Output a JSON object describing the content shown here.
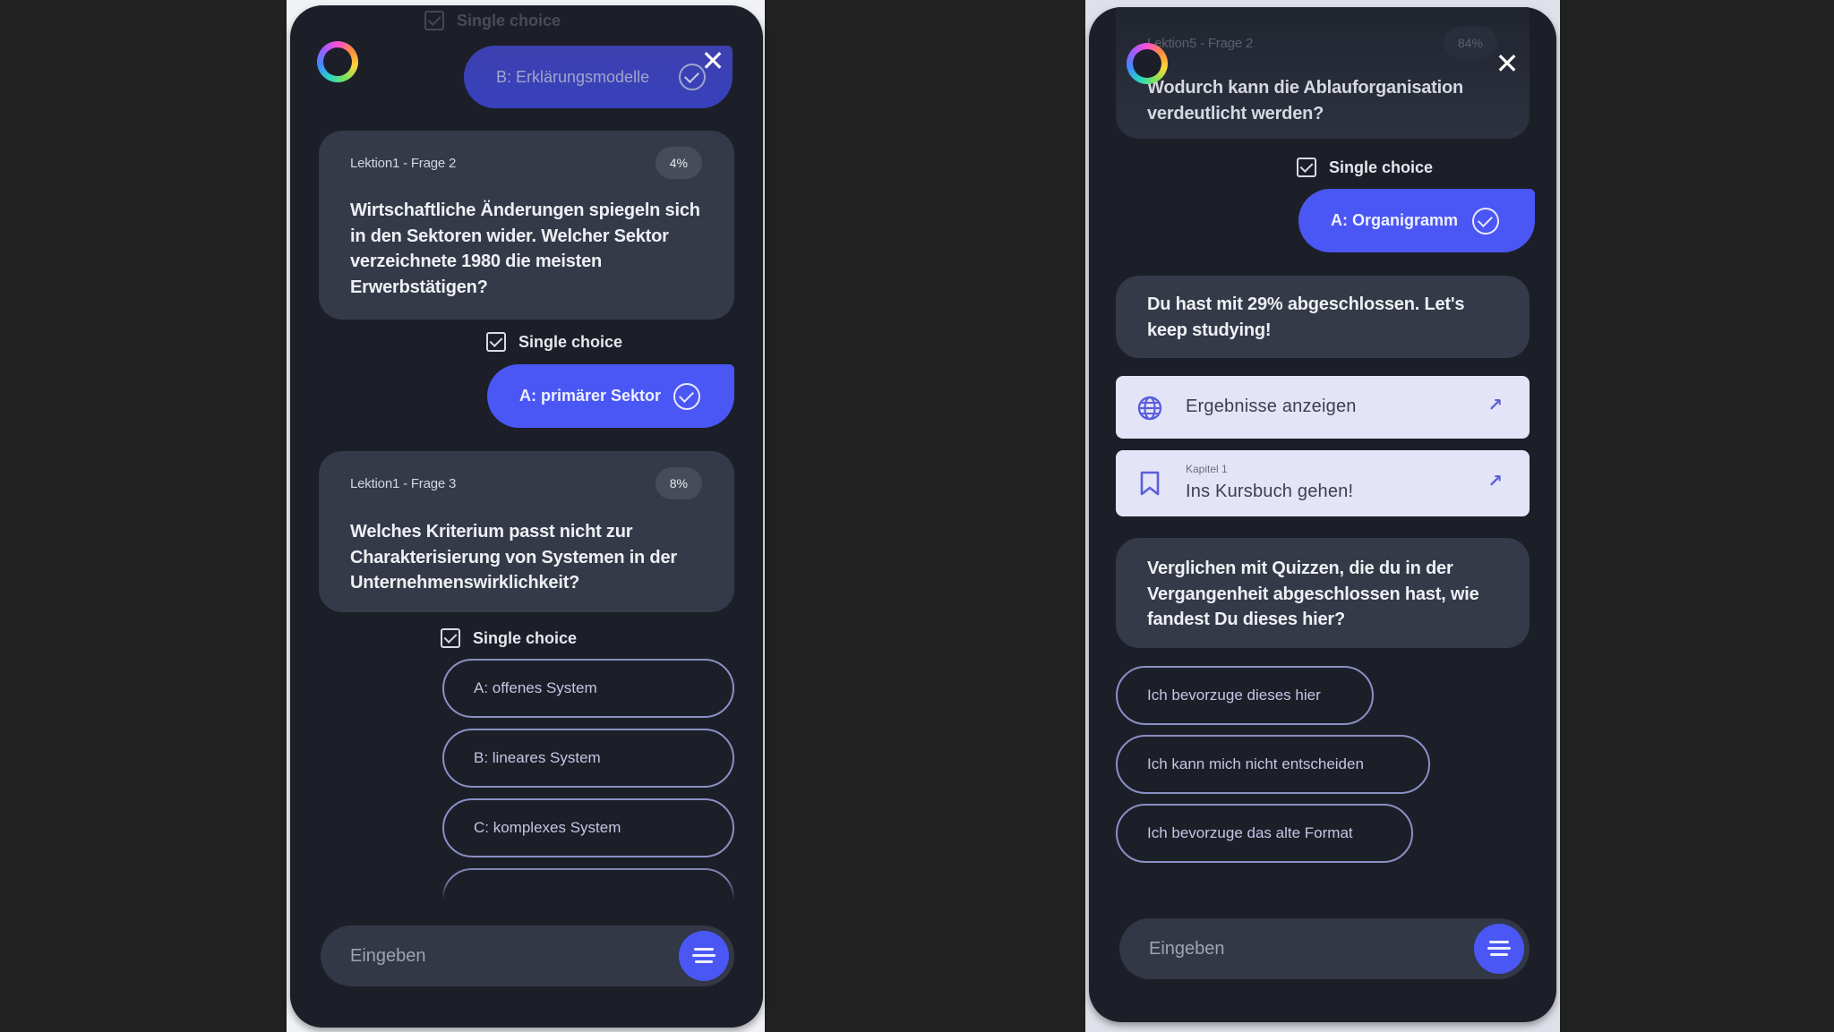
{
  "left_panel": {
    "faded_single_choice_label": "Single choice",
    "previous_answer": "B: Erklärungsmodelle",
    "close_label": "✕",
    "questions": [
      {
        "meta": "Lektion1 - Frage 2",
        "progress": "4%",
        "text": "Wirtschaftliche Änderungen spiegeln sich in den Sektoren wider. Welcher Sektor verzeichnete 1980 die meisten Erwerbstätigen?",
        "mode": "Single choice",
        "selected_answer": "A: primärer Sektor"
      },
      {
        "meta": "Lektion1 - Frage 3",
        "progress": "8%",
        "text": "Welches Kriterium passt nicht zur Charakterisierung von Systemen in der Unternehmenswirklichkeit?",
        "mode": "Single choice",
        "options": [
          "A: offenes System",
          "B: lineares System",
          "C: komplexes System",
          ""
        ]
      }
    ],
    "input_placeholder": "Eingeben"
  },
  "right_panel": {
    "close_label": "✕",
    "question": {
      "meta": "Lektion5 - Frage 2",
      "progress": "84%",
      "text": "Wodurch kann die Ablauforganisation verdeutlicht werden?",
      "mode": "Single choice",
      "selected_answer": "A: Organigramm"
    },
    "result_message": "Du hast mit 29% abgeschlossen. Let's keep studying!",
    "links": [
      {
        "icon": "globe-icon",
        "title": "Ergebnisse anzeigen",
        "subtitle": ""
      },
      {
        "icon": "bookmark-icon",
        "title": "Ins Kursbuch gehen!",
        "subtitle": "Kapitel 1"
      }
    ],
    "feedback_question": "Verglichen mit Quizzen, die du in der Vergangenheit abgeschlossen hast, wie fandest Du dieses hier?",
    "feedback_options": [
      "Ich bevorzuge dieses hier",
      "Ich kann mich nicht entscheiden",
      "Ich bevorzuge das alte Format"
    ],
    "input_placeholder": "Eingeben"
  },
  "colors": {
    "accent": "#4a57f5",
    "panel_bg": "#1c1f28",
    "card_bg": "#353a48",
    "option_border": "#8b8fc4",
    "link_card_bg": "#e4e4f9"
  }
}
